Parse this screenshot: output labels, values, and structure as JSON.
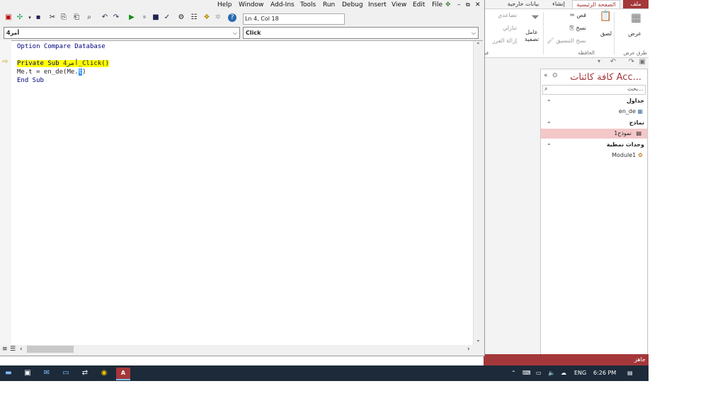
{
  "vbe": {
    "menus": {
      "file": "File",
      "edit": "Edit",
      "view": "View",
      "insert": "Insert",
      "debug": "Debug",
      "run": "Run",
      "tools": "Tools",
      "addins": "Add-Ins",
      "window": "Window",
      "help": "Help"
    },
    "position": "Ln 4, Col 18",
    "object_combo": "أمر4",
    "proc_combo": "Click",
    "code": {
      "line1": "Option Compare Database",
      "line2a": "Private Sub ",
      "line2b": "أمر4_Click()",
      "line3a": "Me.t = en_de(Me.",
      "line3sel": "t",
      "line3b": ")",
      "line4": "End Sub"
    }
  },
  "access": {
    "tabs": {
      "file": "ملف",
      "home": "الصفحة الرئيسية",
      "create": "إنشاء",
      "external": "بيانات خارجية"
    },
    "ribbon": {
      "view": "عرض",
      "views_group": "طرق عرض",
      "paste": "لصق",
      "cut": "قص",
      "copy": "نسخ",
      "format_painter": "نسخ التنسيق",
      "clipboard_group": "الحافظة",
      "filter": "عامل تصفية",
      "ascending": "تصاعدي",
      "descending": "تنازلي",
      "remove_sort": "إزالة الفرز",
      "sort_group": "فر"
    },
    "nav": {
      "title": "كافة كائنات Acc...",
      "search_placeholder": "بحث...",
      "sec_tables": "جداول",
      "table1": "en_de",
      "sec_forms": "نماذج",
      "form1": "نموذج1",
      "sec_modules": "وحدات نمطية",
      "module1": "Module1"
    },
    "status": "جاهز"
  },
  "taskbar": {
    "lang": "ENG",
    "time": "6:26 PM"
  },
  "colors": {
    "access_accent": "#a4373a",
    "taskbar": "#1c2a3a",
    "highlight": "#ffff00",
    "selection": "#3399ff"
  }
}
